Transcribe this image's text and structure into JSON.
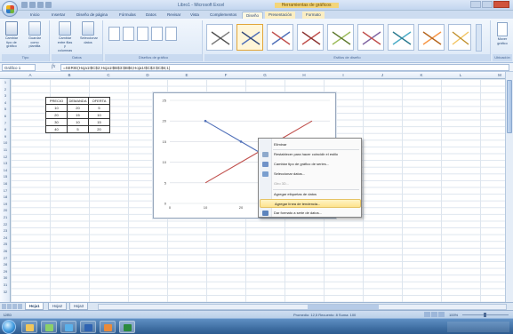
{
  "window": {
    "title": "Libro1 - Microsoft Excel",
    "context_title": "Herramientas de gráficos"
  },
  "ribbon_tabs": [
    {
      "label": "Inicio"
    },
    {
      "label": "Insertar"
    },
    {
      "label": "Diseño de página"
    },
    {
      "label": "Fórmulas"
    },
    {
      "label": "Datos"
    },
    {
      "label": "Revisar"
    },
    {
      "label": "Vista"
    },
    {
      "label": "Complementos"
    },
    {
      "label": "Diseño"
    },
    {
      "label": "Presentación"
    },
    {
      "label": "Formato"
    }
  ],
  "ribbon": {
    "groups": [
      {
        "label": "Tipo"
      },
      {
        "label": "Datos"
      },
      {
        "label": "Diseños de gráfico"
      },
      {
        "label": "Estilos de diseño"
      },
      {
        "label": "Ubicación"
      }
    ],
    "buttons": [
      {
        "label": "Cambiar tipo de gráfico"
      },
      {
        "label": "Guardar como plantilla"
      },
      {
        "label": "Cambiar entre filas y columnas"
      },
      {
        "label": "Seleccionar datos"
      }
    ],
    "move_chart": "Mover gráfico"
  },
  "formula_bar": {
    "name_box": "Gráfico 1",
    "fx": "fx",
    "value": "=SERIE(Hoja1!$C$2;Hoja1!$B$3:$B$6;Hoja1!$C$3:$C$6;1)"
  },
  "columns": [
    "A",
    "B",
    "C",
    "D",
    "E",
    "F",
    "G",
    "H",
    "I",
    "J",
    "K",
    "L",
    "M"
  ],
  "rows": [
    "1",
    "2",
    "3",
    "4",
    "5",
    "6",
    "7",
    "8",
    "9",
    "10",
    "11",
    "12",
    "13",
    "14",
    "15",
    "16",
    "17",
    "18",
    "19",
    "20",
    "21",
    "22",
    "23",
    "24",
    "25",
    "26",
    "27",
    "28",
    "29",
    "30",
    "31",
    "32"
  ],
  "table": {
    "headers": [
      "PRECIO",
      "DEMANDA",
      "OFERTA"
    ],
    "rows": [
      [
        "10",
        "20",
        "5"
      ],
      [
        "20",
        "15",
        "10"
      ],
      [
        "30",
        "10",
        "15"
      ],
      [
        "40",
        "5",
        "20"
      ]
    ]
  },
  "chart_data": {
    "type": "line",
    "x_ticks": [
      "0",
      "10",
      "20"
    ],
    "y_ticks": [
      "0",
      "5",
      "10",
      "15",
      "20",
      "25"
    ],
    "ylim": [
      0,
      25
    ],
    "series": [
      {
        "x": [
          10,
          20,
          30,
          40
        ],
        "values": [
          20,
          15,
          10,
          5
        ],
        "color": "#4f6fb8"
      },
      {
        "x": [
          10,
          20,
          30,
          40
        ],
        "values": [
          5,
          10,
          15,
          20
        ],
        "color": "#c0504d"
      }
    ]
  },
  "context_menu": {
    "items": [
      {
        "label": "Eliminar",
        "icon": "none"
      },
      {
        "label": "Restablecer para hacer coincidir el estilo",
        "icon": "reset-icon"
      },
      {
        "label": "Cambiar tipo de gráfico de series...",
        "icon": "chart-type-icon"
      },
      {
        "label": "Seleccionar datos...",
        "icon": "select-data-icon"
      },
      {
        "label": "Giro 3D...",
        "icon": "none"
      },
      {
        "label": "Agregar etiquetas de datos",
        "icon": "none"
      },
      {
        "label": "Agregar línea de tendencia...",
        "icon": "none",
        "highlighted": true
      },
      {
        "label": "Dar formato a serie de datos...",
        "icon": "format-icon"
      }
    ]
  },
  "sheets": [
    {
      "label": "Hoja1",
      "active": true
    },
    {
      "label": "Hoja2"
    },
    {
      "label": "Hoja3"
    }
  ],
  "status": {
    "ready": "Listo",
    "stats": "Promedio: 12,5   Recuento: 8   Suma: 100",
    "zoom": "100%"
  },
  "colors": {
    "accent": "#4f6fb8",
    "series_red": "#c0504d",
    "menu_highlight": "#fde38d"
  }
}
